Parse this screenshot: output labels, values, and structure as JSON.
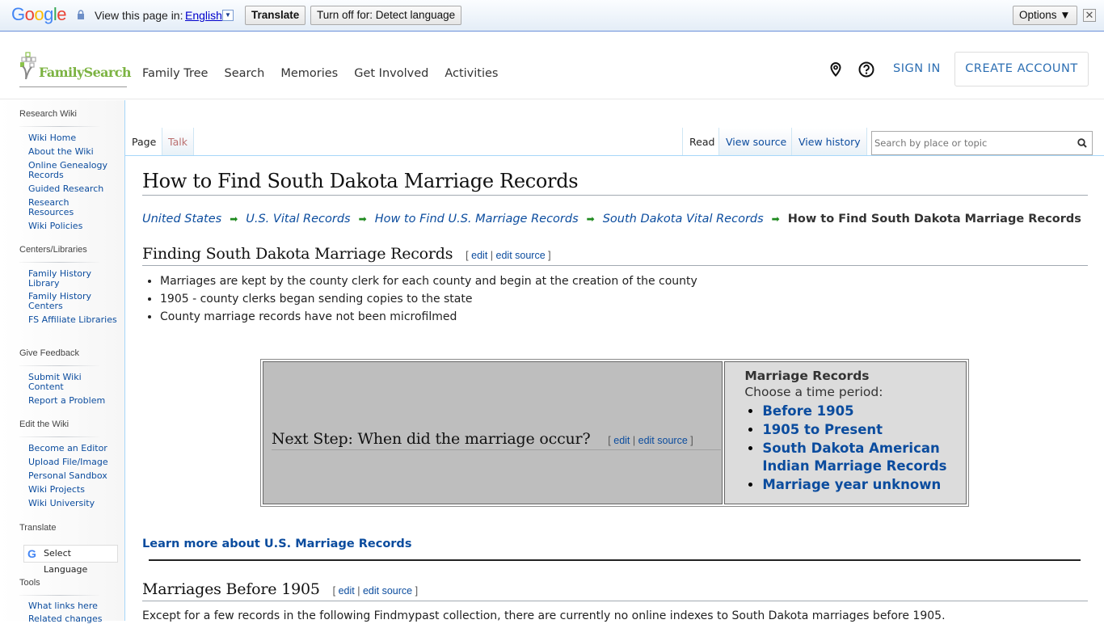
{
  "translate_bar": {
    "logo": "Google",
    "view_label": "View this page in:",
    "language": "English",
    "translate_button": "Translate",
    "turn_off_button": "Turn off for: Detect language",
    "options_button": "Options ▼",
    "close": "✕"
  },
  "header": {
    "logo_text": "FamilySearch",
    "nav": [
      "Family Tree",
      "Search",
      "Memories",
      "Get Involved",
      "Activities"
    ],
    "sign_in": "SIGN IN",
    "create_account": "CREATE ACCOUNT",
    "icons": [
      "location-pin-icon",
      "help-icon"
    ]
  },
  "sidebar": {
    "sections": [
      {
        "heading": "Research Wiki",
        "items": [
          "Wiki Home",
          "About the Wiki",
          "Online Genealogy Records",
          "Guided Research",
          "Research Resources",
          "Wiki Policies"
        ]
      },
      {
        "heading": "Centers/Libraries",
        "items": [
          "Family History Library",
          "Family History Centers",
          "FS Affiliate Libraries"
        ]
      },
      {
        "heading": "Give Feedback",
        "items": [
          "Submit Wiki Content",
          "Report a Problem"
        ]
      },
      {
        "heading": "Edit the Wiki",
        "items": [
          "Become an Editor",
          "Upload File/Image",
          "Personal Sandbox",
          "Wiki Projects",
          "Wiki University"
        ]
      },
      {
        "heading": "Translate",
        "items": []
      },
      {
        "heading": "Tools",
        "items": [
          "What links here",
          "Related changes"
        ]
      }
    ],
    "select_language": "Select Language"
  },
  "tabs": {
    "left": [
      "Page",
      "Talk"
    ],
    "right": [
      "Read",
      "View source",
      "View history"
    ],
    "search_placeholder": "Search by place or topic"
  },
  "page": {
    "title": "How to Find South Dakota Marriage Records",
    "breadcrumbs": [
      "United States",
      "U.S. Vital Records",
      "How to Find U.S. Marriage Records",
      "South Dakota Vital Records"
    ],
    "breadcrumb_current": "How to Find South Dakota Marriage Records",
    "breadcrumb_sep": "➡",
    "edit_links": {
      "open": "[",
      "edit": "edit",
      "sep": "|",
      "edit_source": "edit source",
      "close": "]"
    },
    "section1": {
      "heading": "Finding South Dakota Marriage Records",
      "bullets": [
        "Marriages are kept by the county clerk for each county and begin at the creation of the county",
        "1905 - county clerks began sending copies to the state",
        "County marriage records have not been microfilmed"
      ]
    },
    "next_step": {
      "heading": "Next Step: When did the marriage occur?",
      "box_title": "Marriage Records",
      "box_subtitle": "Choose a time period:",
      "links": [
        "Before 1905",
        "1905 to Present",
        "South Dakota American Indian Marriage Records",
        "Marriage year unknown"
      ]
    },
    "learn_more": "Learn more about U.S. Marriage Records",
    "section2": {
      "heading": "Marriages Before 1905",
      "text": "Except for a few records in the following Findmypast collection, there are currently no online indexes to South Dakota marriages before 1905."
    }
  }
}
